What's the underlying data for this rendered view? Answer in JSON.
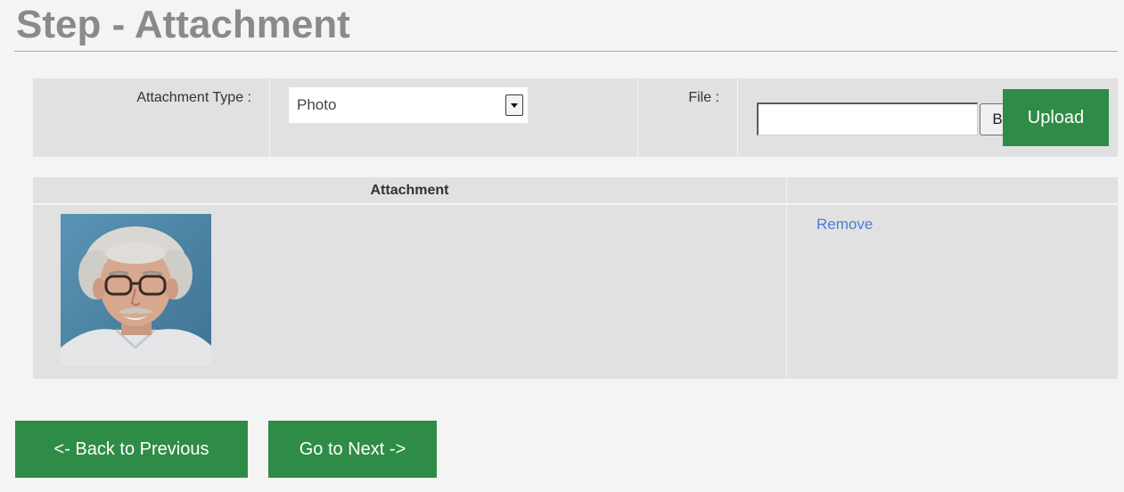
{
  "page": {
    "title": "Step - Attachment"
  },
  "form": {
    "attachment_type_label": "Attachment Type :",
    "attachment_type_value": "Photo",
    "file_label": "File :",
    "file_value": "",
    "browse_label": "B",
    "upload_label": "Upload"
  },
  "table": {
    "headers": [
      "Attachment",
      ""
    ],
    "rows": [
      {
        "image": "portrait-photo",
        "action": "Remove"
      }
    ]
  },
  "nav": {
    "back_label": "<- Back to Previous",
    "next_label": "Go to Next ->"
  },
  "colors": {
    "accent": "#2f8c47",
    "link": "#4a7ed8",
    "panel": "#e1e1e1",
    "background": "#f4f4f4",
    "title": "#8a8a8a"
  }
}
